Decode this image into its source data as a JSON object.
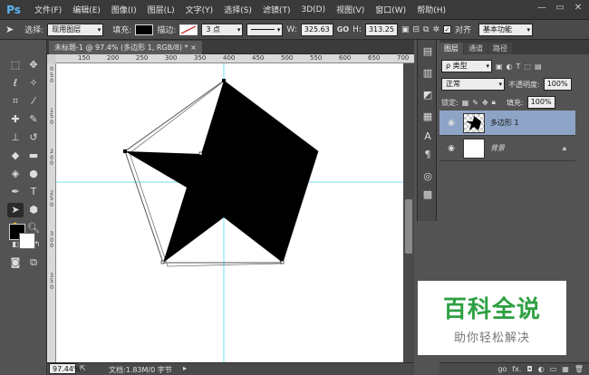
{
  "app": {
    "logo": "Ps"
  },
  "menu": [
    "文件(F)",
    "编辑(E)",
    "图像(I)",
    "图层(L)",
    "文字(Y)",
    "选择(S)",
    "滤镜(T)",
    "3D(D)",
    "视图(V)",
    "窗口(W)",
    "帮助(H)"
  ],
  "window_controls": {
    "minimize": "—",
    "restore": "▭",
    "close": "✕"
  },
  "options": {
    "select_label": "选择:",
    "select_value": "现用图层",
    "fill_label": "填充:",
    "stroke_label": "描边:",
    "stroke_size": "3 点",
    "w_label": "W:",
    "w_value": "325.63",
    "link": "GO",
    "h_label": "H:",
    "h_value": "313.25",
    "align_label": "对齐",
    "workspace": "基本功能",
    "fill_color": "#000000",
    "stroke_color": "#d23a3a"
  },
  "document": {
    "tab_title": "未标题-1 @ 97.4% (多边形 1, RGB/8) *",
    "tab_close": "×",
    "ruler_h": [
      "150",
      "200",
      "250",
      "300",
      "350",
      "400",
      "450",
      "500",
      "550",
      "600",
      "650",
      "700"
    ],
    "ruler_v": [
      "0",
      "5",
      "0",
      "1",
      "5",
      "0",
      "2",
      "0",
      "0",
      "2",
      "5",
      "0",
      "3",
      "0",
      "0",
      "3",
      "5",
      "0",
      "4",
      "0",
      "0",
      "4",
      "5",
      "0"
    ],
    "zoom": "97.44%",
    "doc_info": "文档:1.83M/0 字节"
  },
  "panel_strip_icons": [
    "history-icon",
    "properties-icon",
    "adjust-icon",
    "styles-icon",
    "character-icon",
    "paragraph-icon",
    "3d-icon",
    "grid-icon"
  ],
  "layers_panel": {
    "tabs": [
      "图层",
      "通道",
      "路径"
    ],
    "kind_label": "ρ 类型",
    "blend_mode": "正常",
    "opacity_label": "不透明度:",
    "opacity_value": "100%",
    "lock_label": "锁定:",
    "fill_label": "填充:",
    "fill_value": "100%",
    "layers": [
      {
        "name": "多边形 1",
        "selected": true
      },
      {
        "name": "背景",
        "selected": false
      }
    ],
    "bottom_icons": [
      "ɡo",
      "fx.",
      "◘",
      "◐",
      "▭",
      "▦",
      "🗑"
    ]
  },
  "watermark": {
    "title": "百科全说",
    "subtitle": "助你轻松解决"
  }
}
